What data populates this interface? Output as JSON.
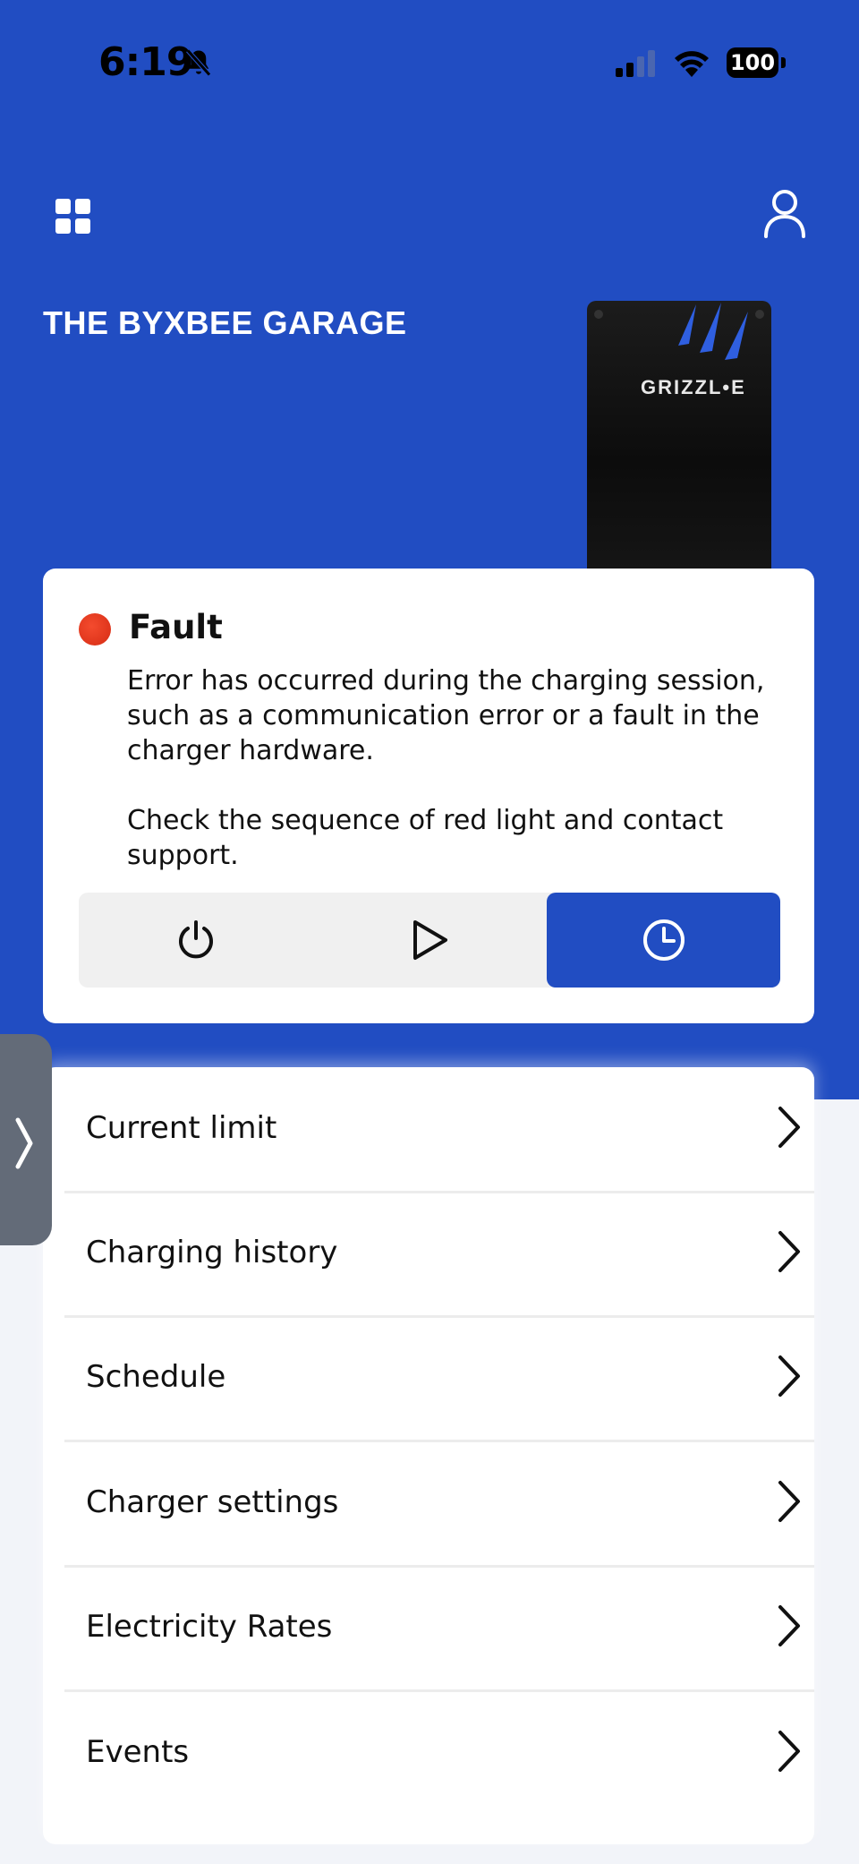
{
  "status_bar": {
    "time": "6:19",
    "battery": "100",
    "icons": [
      "bell-slash-icon",
      "signal-icon",
      "wifi-icon",
      "battery-icon"
    ]
  },
  "header": {
    "menu_icon": "grid-icon",
    "profile_icon": "user-icon",
    "location_name": "THE BYXBEE GARAGE"
  },
  "charger": {
    "brand": "GRIZZL•E"
  },
  "fault": {
    "status": "Fault",
    "status_color": "#e0341a",
    "description": "Error has occurred during the charging session, such as a communication error or a fault in the charger hardware.\n\nCheck the sequence of red light and contact support.",
    "controls": [
      {
        "icon": "power-icon",
        "active": false
      },
      {
        "icon": "play-icon",
        "active": false
      },
      {
        "icon": "clock-icon",
        "active": true
      }
    ]
  },
  "menu": {
    "items": [
      {
        "label": "Current limit"
      },
      {
        "label": "Charging history"
      },
      {
        "label": "Schedule"
      },
      {
        "label": "Charger settings"
      },
      {
        "label": "Electricity Rates"
      },
      {
        "label": "Events"
      }
    ]
  },
  "side_tab": {
    "icon": "chevron-right-icon"
  },
  "colors": {
    "brand_blue": "#214dc2",
    "background": "#f2f4f9",
    "side_tab": "#636b78"
  }
}
